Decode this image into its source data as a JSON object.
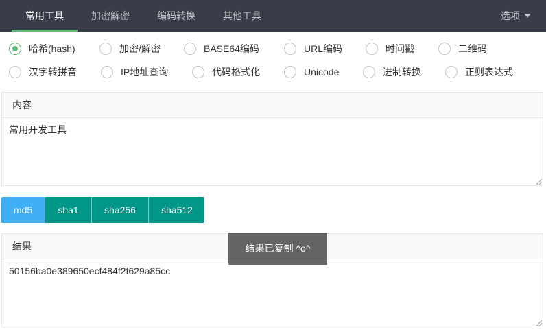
{
  "nav": {
    "tabs": [
      {
        "label": "常用工具"
      },
      {
        "label": "加密解密"
      },
      {
        "label": "编码转换"
      },
      {
        "label": "其他工具"
      }
    ],
    "options_label": "选项"
  },
  "tools": {
    "selected": "哈希(hash)",
    "row1": [
      "哈希(hash)",
      "加密/解密",
      "BASE64编码",
      "URL编码",
      "时间戳",
      "二维码"
    ],
    "row2": [
      "汉字转拼音",
      "IP地址查询",
      "代码格式化",
      "Unicode",
      "进制转换",
      "正则表达式"
    ]
  },
  "input": {
    "heading": "内容",
    "value": "常用开发工具"
  },
  "hash_buttons": [
    "md5",
    "sha1",
    "sha256",
    "sha512"
  ],
  "result": {
    "heading": "结果",
    "value": "50156ba0e389650ecf484f2f629a85cc"
  },
  "toast": "结果已复制 ^o^",
  "colors": {
    "nav_bg": "#393d49",
    "accent_green": "#5fb878",
    "button_teal": "#009688",
    "button_active_blue": "#40aef4"
  }
}
